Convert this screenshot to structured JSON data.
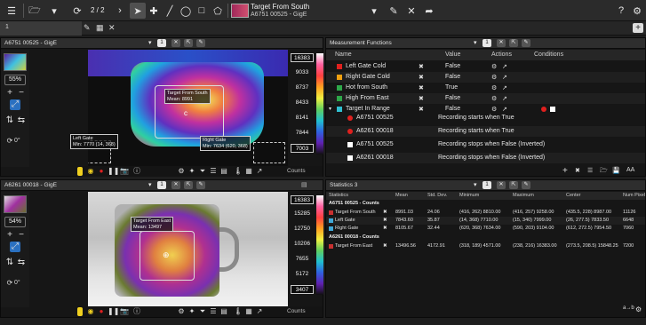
{
  "toolbar": {
    "page_indicator": "2 / 2",
    "camera_title": "Target From South",
    "camera_subtitle": "A6751 00525 - GigE"
  },
  "tabs": [
    "1"
  ],
  "panel_top": {
    "title": "A6751 00525 - GigE",
    "num": "1",
    "zoom": "55%",
    "angle": "0°",
    "scale_max": "16383",
    "scale_ticks": [
      "9033",
      "8737",
      "8433",
      "8141",
      "7844"
    ],
    "scale_min": "7003",
    "units": "Counts",
    "annotations": [
      {
        "name": "Target From South",
        "value": "Mean: 8991"
      },
      {
        "name": "Left Gate",
        "value": "Min: 7770 (14, 368)"
      },
      {
        "name": "Right Gate",
        "value": "Min: 7634 (620, 368)"
      }
    ]
  },
  "panel_bottom": {
    "title": "A6261 00018 - GigE",
    "num": "1",
    "zoom": "54%",
    "angle": "0°",
    "scale_max": "16383",
    "scale_ticks": [
      "15285",
      "12750",
      "10206",
      "7655",
      "5172"
    ],
    "scale_min": "3407",
    "units": "Counts",
    "annotations": [
      {
        "name": "Target From East",
        "value": "Mean: 13497"
      }
    ]
  },
  "measurement_functions": {
    "title": "Measurement Functions",
    "num": "1",
    "columns": [
      "Name",
      "Value",
      "Actions",
      "Conditions"
    ],
    "rows": [
      {
        "name": "Left Gate Cold",
        "value": "False",
        "color": "#e0201e"
      },
      {
        "name": "Right Gate Cold",
        "value": "False",
        "color": "#f0a010"
      },
      {
        "name": "Hot from South",
        "value": "True",
        "color": "#2ea84a"
      },
      {
        "name": "High From East",
        "value": "False",
        "color": "#2ea84a"
      },
      {
        "name": "Target In Range",
        "value": "False",
        "color": "#30c0d0"
      }
    ],
    "subrows": [
      {
        "camera": "A6751 00525",
        "text": "Recording starts when True",
        "marker": "red-dot"
      },
      {
        "camera": "A6261 00018",
        "text": "Recording starts when True",
        "marker": "red-dot"
      },
      {
        "camera": "A6751 00525",
        "text": "Recording stops when False (Inverted)",
        "marker": "white-box"
      },
      {
        "camera": "A6261 00018",
        "text": "Recording stops when False (Inverted)",
        "marker": "white-box"
      }
    ]
  },
  "statistics": {
    "title": "Statistics 3",
    "num": "1",
    "columns": [
      "Statistics",
      "Mean",
      "Std. Dev.",
      "Minimum",
      "Maximum",
      "Center",
      "Num Pixel"
    ],
    "groups": [
      {
        "label": "A6751 00525 - Counts",
        "rows": [
          {
            "name": "Target From South",
            "color": "#c83030",
            "mean": "8991.03",
            "std": "24.06",
            "min": "(416, 262) 8810.00",
            "max": "(416, 257) 9258.00",
            "center": "(435.5, 228) 8987.00",
            "pixels": "11126"
          },
          {
            "name": "Left Gate",
            "color": "#40a8d8",
            "mean": "7843.60",
            "std": "35.87",
            "min": "(14, 368) 7710.00",
            "max": "(15, 340) 7999.00",
            "center": "(26, 277.5) 7833.50",
            "pixels": "6648"
          },
          {
            "name": "Right Gate",
            "color": "#40a8d8",
            "mean": "8105.67",
            "std": "32.44",
            "min": "(620, 368) 7634.00",
            "max": "(590, 203) 9104.00",
            "center": "(612, 272.5) 7954.50",
            "pixels": "7060"
          }
        ]
      },
      {
        "label": "A6261 00018 - Counts",
        "rows": [
          {
            "name": "Target From East",
            "color": "#c83030",
            "mean": "13496.56",
            "std": "4172.91",
            "min": "(318, 189) 4571.00",
            "max": "(238, 216) 16383.00",
            "center": "(273.5, 208.5) 15848.25",
            "pixels": "7200"
          }
        ]
      }
    ]
  }
}
